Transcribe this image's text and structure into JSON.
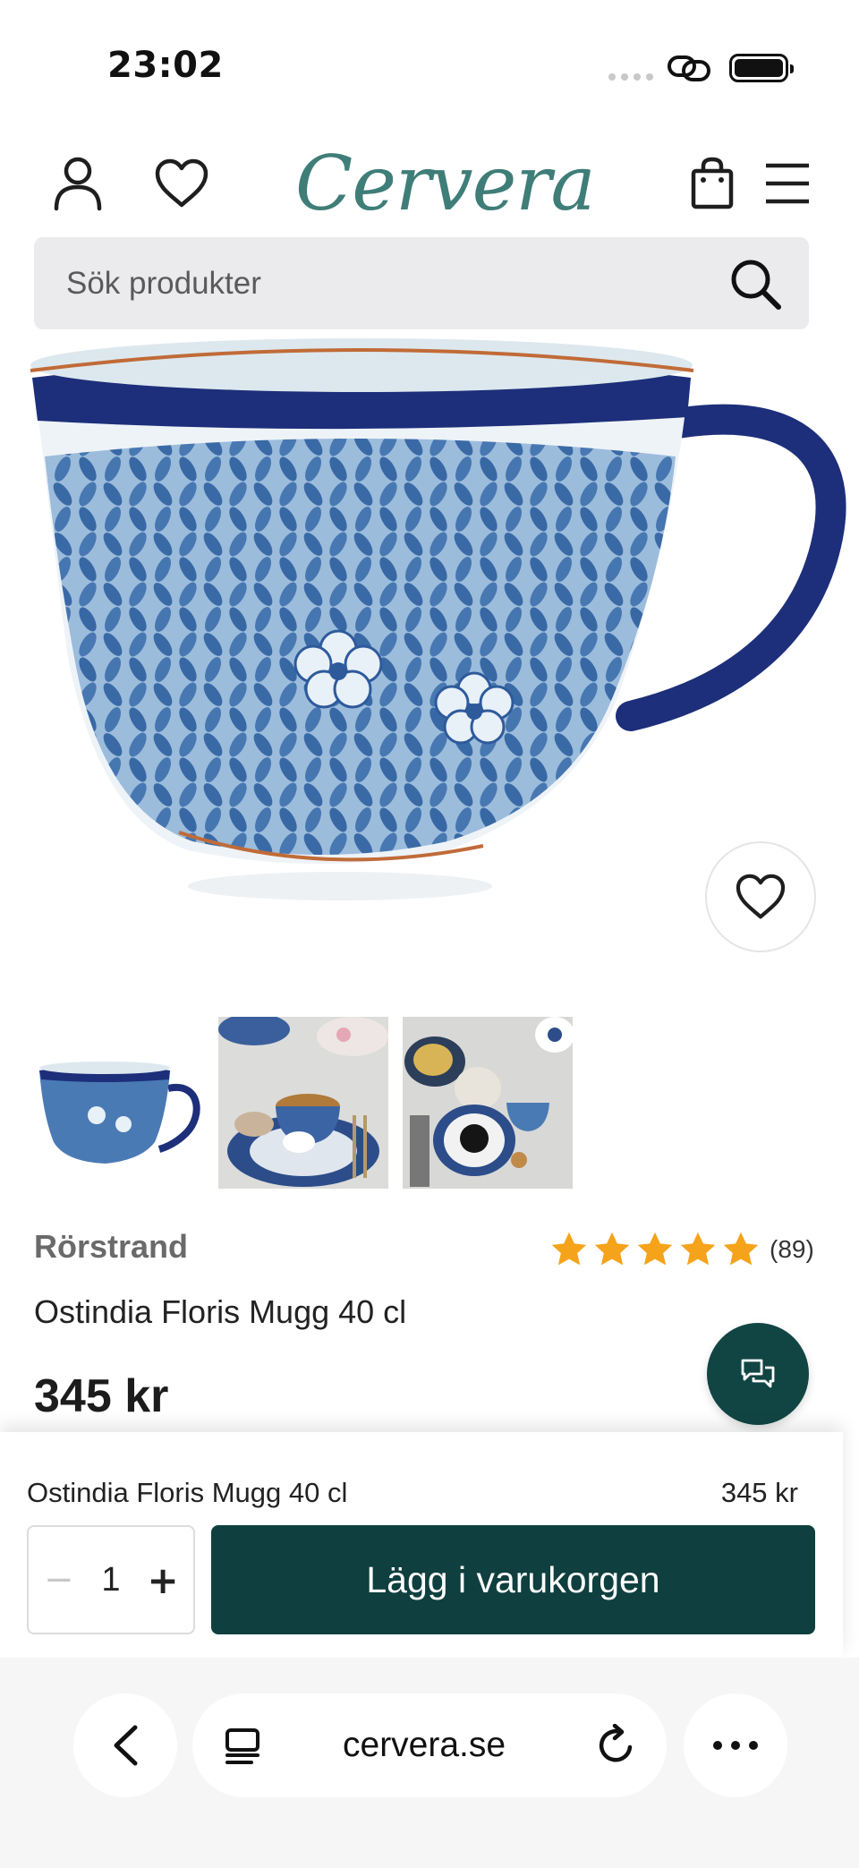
{
  "status_bar": {
    "time": "23:02"
  },
  "header": {
    "logo": "Cervera",
    "icons": [
      "account-icon",
      "wishlist-icon",
      "cart-icon",
      "menu-icon"
    ]
  },
  "search": {
    "placeholder": "Sök produkter"
  },
  "product": {
    "brand": "Rörstrand",
    "name": "Ostindia Floris Mugg 40 cl",
    "price": "345 kr",
    "rating": {
      "stars": 5,
      "max": 5,
      "count": "(89)"
    },
    "thumbnails": [
      "mug-thumbnail",
      "table-setting-thumbnail-1",
      "table-setting-thumbnail-2"
    ]
  },
  "sticky_cart": {
    "name": "Ostindia Floris Mugg 40 cl",
    "price": "345 kr",
    "quantity": "1",
    "minus_label": "−",
    "plus_label": "+",
    "add_label": "Lägg i varukorgen"
  },
  "browser": {
    "url": "cervera.se"
  },
  "colors": {
    "brand_teal": "#3f7d78",
    "button_dark": "#0f3f3e",
    "chat_button": "#114544",
    "star_gold": "#f5a31a",
    "search_bg": "#ebebed"
  }
}
